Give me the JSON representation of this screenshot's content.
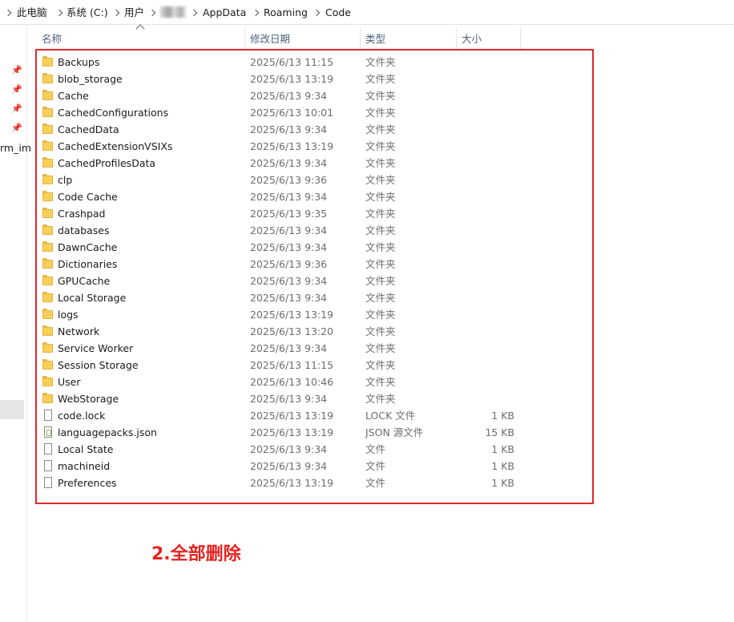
{
  "breadcrumb": {
    "items": [
      "此电脑",
      "系统 (C:)",
      "用户",
      "AppData",
      "Roaming",
      "Code"
    ]
  },
  "nav": {
    "partial_label": "rm_im"
  },
  "columns": {
    "name": "名称",
    "date": "修改日期",
    "type": "类型",
    "size": "大小"
  },
  "files": [
    {
      "name": "Backups",
      "date": "2025/6/13 11:15",
      "type": "文件夹",
      "size": "",
      "icon": "folder-icon"
    },
    {
      "name": "blob_storage",
      "date": "2025/6/13 13:19",
      "type": "文件夹",
      "size": "",
      "icon": "folder-icon"
    },
    {
      "name": "Cache",
      "date": "2025/6/13 9:34",
      "type": "文件夹",
      "size": "",
      "icon": "folder-icon"
    },
    {
      "name": "CachedConfigurations",
      "date": "2025/6/13 10:01",
      "type": "文件夹",
      "size": "",
      "icon": "folder-icon"
    },
    {
      "name": "CachedData",
      "date": "2025/6/13 9:34",
      "type": "文件夹",
      "size": "",
      "icon": "folder-icon"
    },
    {
      "name": "CachedExtensionVSIXs",
      "date": "2025/6/13 13:19",
      "type": "文件夹",
      "size": "",
      "icon": "folder-icon"
    },
    {
      "name": "CachedProfilesData",
      "date": "2025/6/13 9:34",
      "type": "文件夹",
      "size": "",
      "icon": "folder-icon"
    },
    {
      "name": "clp",
      "date": "2025/6/13 9:36",
      "type": "文件夹",
      "size": "",
      "icon": "folder-icon"
    },
    {
      "name": "Code Cache",
      "date": "2025/6/13 9:34",
      "type": "文件夹",
      "size": "",
      "icon": "folder-icon"
    },
    {
      "name": "Crashpad",
      "date": "2025/6/13 9:35",
      "type": "文件夹",
      "size": "",
      "icon": "folder-icon"
    },
    {
      "name": "databases",
      "date": "2025/6/13 9:34",
      "type": "文件夹",
      "size": "",
      "icon": "folder-icon"
    },
    {
      "name": "DawnCache",
      "date": "2025/6/13 9:34",
      "type": "文件夹",
      "size": "",
      "icon": "folder-icon"
    },
    {
      "name": "Dictionaries",
      "date": "2025/6/13 9:36",
      "type": "文件夹",
      "size": "",
      "icon": "folder-icon"
    },
    {
      "name": "GPUCache",
      "date": "2025/6/13 9:34",
      "type": "文件夹",
      "size": "",
      "icon": "folder-icon"
    },
    {
      "name": "Local Storage",
      "date": "2025/6/13 9:34",
      "type": "文件夹",
      "size": "",
      "icon": "folder-icon"
    },
    {
      "name": "logs",
      "date": "2025/6/13 13:19",
      "type": "文件夹",
      "size": "",
      "icon": "folder-icon"
    },
    {
      "name": "Network",
      "date": "2025/6/13 13:20",
      "type": "文件夹",
      "size": "",
      "icon": "folder-icon"
    },
    {
      "name": "Service Worker",
      "date": "2025/6/13 9:34",
      "type": "文件夹",
      "size": "",
      "icon": "folder-icon"
    },
    {
      "name": "Session Storage",
      "date": "2025/6/13 11:15",
      "type": "文件夹",
      "size": "",
      "icon": "folder-icon"
    },
    {
      "name": "User",
      "date": "2025/6/13 10:46",
      "type": "文件夹",
      "size": "",
      "icon": "folder-icon"
    },
    {
      "name": "WebStorage",
      "date": "2025/6/13 9:34",
      "type": "文件夹",
      "size": "",
      "icon": "folder-icon"
    },
    {
      "name": "code.lock",
      "date": "2025/6/13 13:19",
      "type": "LOCK 文件",
      "size": "1 KB",
      "icon": "file-icon"
    },
    {
      "name": "languagepacks.json",
      "date": "2025/6/13 13:19",
      "type": "JSON 源文件",
      "size": "15 KB",
      "icon": "json-file-icon"
    },
    {
      "name": "Local State",
      "date": "2025/6/13 9:34",
      "type": "文件",
      "size": "1 KB",
      "icon": "file-icon"
    },
    {
      "name": "machineid",
      "date": "2025/6/13 9:34",
      "type": "文件",
      "size": "1 KB",
      "icon": "file-icon"
    },
    {
      "name": "Preferences",
      "date": "2025/6/13 13:19",
      "type": "文件",
      "size": "1 KB",
      "icon": "file-icon"
    }
  ],
  "annotation": {
    "text": "2.全部删除",
    "color": "#e8221f"
  },
  "highlight_color": "#e02a2a"
}
